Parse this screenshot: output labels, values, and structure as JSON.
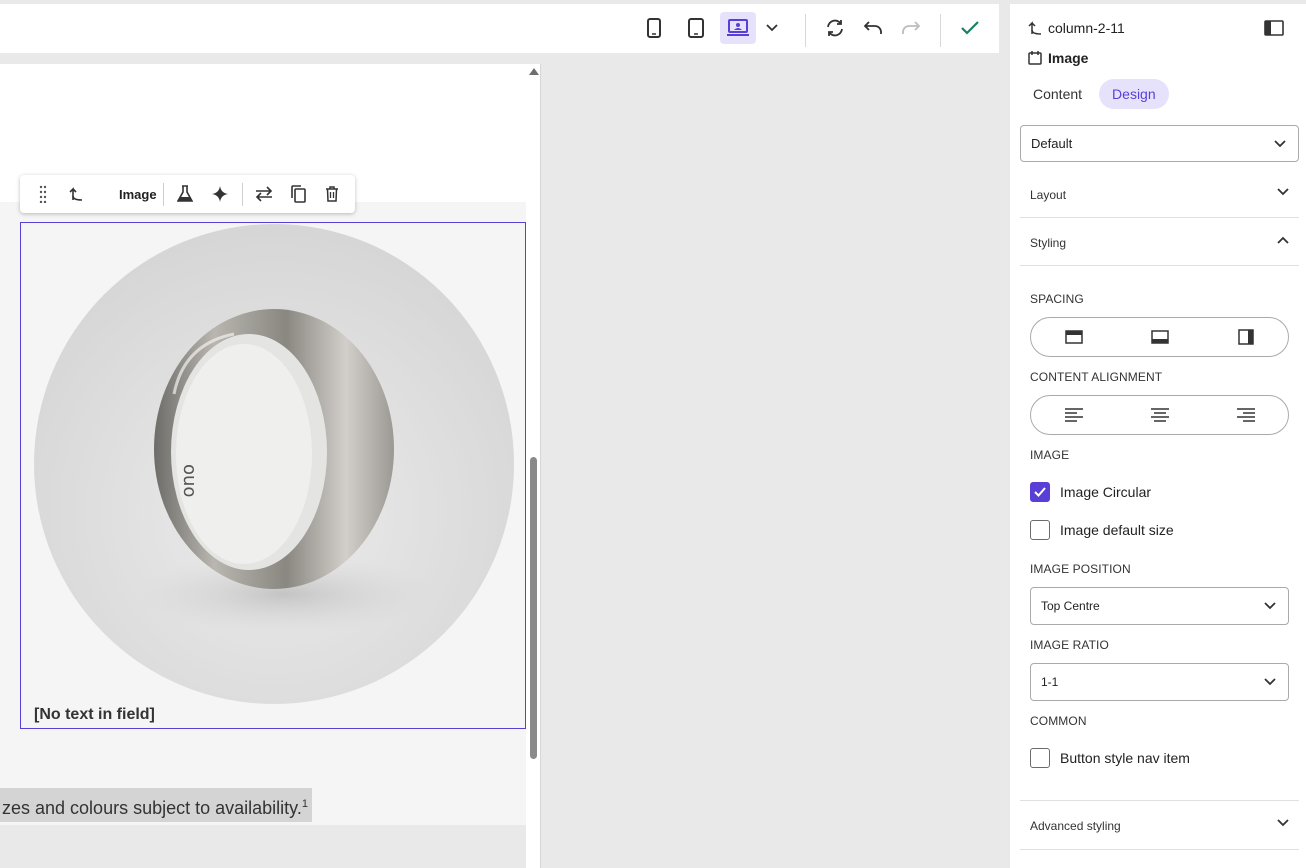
{
  "toolbar": {
    "devices": [
      "mobile-icon",
      "tablet-icon",
      "desktop-icon"
    ],
    "active_device": "desktop",
    "accent": "#5a3fd6",
    "confirm_color": "#1a7f64"
  },
  "element_toolbar": {
    "label": "Image"
  },
  "canvas": {
    "caption": "[No text in field]",
    "footnote_text": "zes and colours subject to availability.",
    "footnote_sup": "1"
  },
  "panel": {
    "breadcrumb": "column-2-11",
    "element_type": "Image",
    "tabs": [
      {
        "label": "Content",
        "active": false
      },
      {
        "label": "Design",
        "active": true
      }
    ],
    "style_select": "Default",
    "accordions": {
      "layout": "Layout",
      "styling": "Styling",
      "advanced": "Advanced styling"
    },
    "sections": {
      "spacing": "SPACING",
      "content_alignment": "CONTENT ALIGNMENT",
      "image": "IMAGE",
      "image_position": "IMAGE POSITION",
      "image_ratio": "IMAGE RATIO",
      "common": "COMMON"
    },
    "checkboxes": {
      "image_circular": {
        "label": "Image Circular",
        "checked": true
      },
      "image_default_size": {
        "label": "Image default size",
        "checked": false
      },
      "button_style_nav": {
        "label": "Button style nav item",
        "checked": false
      }
    },
    "image_position_value": "Top Centre",
    "image_ratio_value": "1-1"
  }
}
